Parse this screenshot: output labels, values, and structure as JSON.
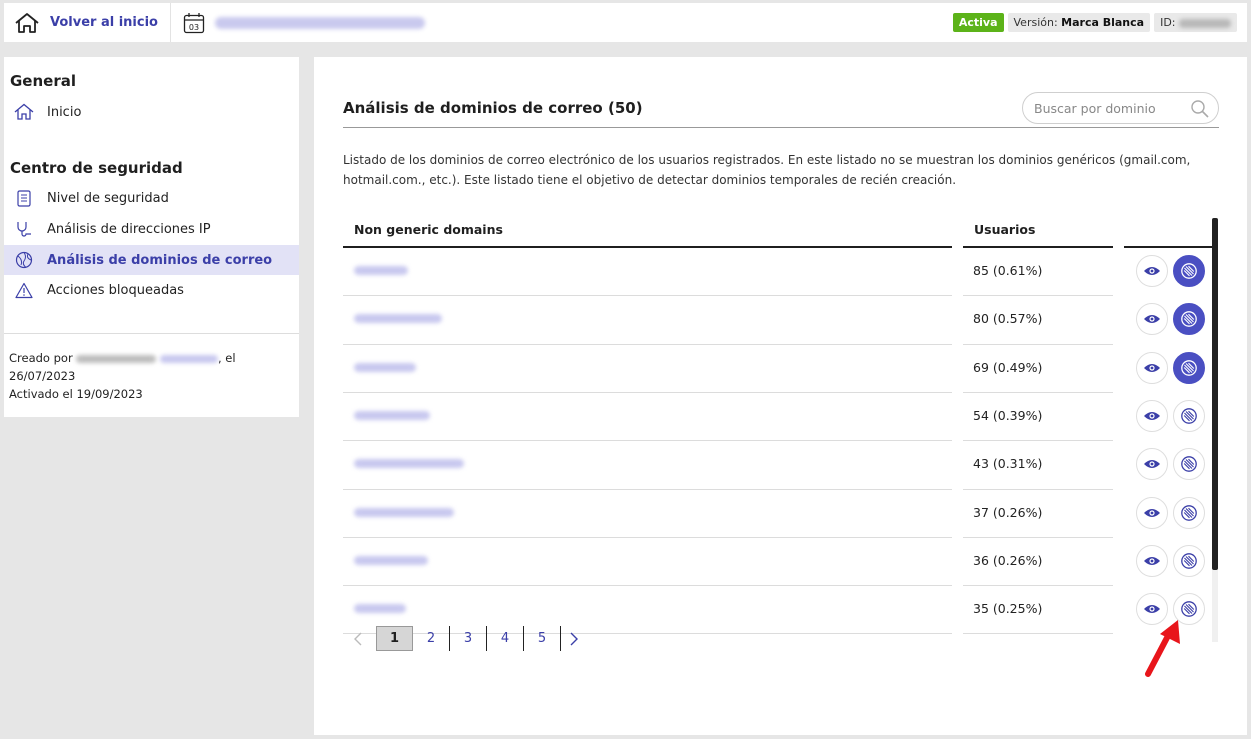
{
  "topbar": {
    "home_label": "Volver al inicio",
    "calendar_day": "03",
    "status_badge": "Activa",
    "version_label": "Versión:",
    "version_value": "Marca Blanca",
    "id_label": "ID:"
  },
  "sidebar": {
    "general_title": "General",
    "general_items": [
      {
        "label": "Inicio",
        "icon": "home-icon"
      }
    ],
    "security_title": "Centro de seguridad",
    "security_items": [
      {
        "label": "Nivel de seguridad",
        "icon": "clipboard-icon"
      },
      {
        "label": "Análisis de direcciones IP",
        "icon": "plug-icon"
      },
      {
        "label": "Análisis de dominios de correo",
        "icon": "globe-icon",
        "active": true
      },
      {
        "label": "Acciones bloqueadas",
        "icon": "warning-icon"
      }
    ],
    "created_prefix": "Creado por",
    "created_suffix": ", el",
    "created_date": "26/07/2023",
    "activated_text": "Activado el 19/09/2023"
  },
  "main": {
    "title": "Análisis de dominios de correo (50)",
    "search_placeholder": "Buscar por dominio",
    "description": "Listado de los dominios de correo electrónico de los usuarios registrados. En este listado no se muestran los dominios genéricos (gmail.com, hotmail.com., etc.). Este listado tiene el objetivo de detectar dominios temporales de recién creación.",
    "columns": {
      "domain": "Non generic domains",
      "users": "Usuarios"
    },
    "rows": [
      {
        "users": "85 (0.61%)",
        "blocked": true
      },
      {
        "users": "80 (0.57%)",
        "blocked": true
      },
      {
        "users": "69 (0.49%)",
        "blocked": true
      },
      {
        "users": "54 (0.39%)",
        "blocked": false
      },
      {
        "users": "43 (0.31%)",
        "blocked": false
      },
      {
        "users": "37 (0.26%)",
        "blocked": false
      },
      {
        "users": "36 (0.26%)",
        "blocked": false
      },
      {
        "users": "35 (0.25%)",
        "blocked": false
      }
    ],
    "pagination": [
      "1",
      "2",
      "3",
      "4",
      "5"
    ],
    "current_page": "1"
  },
  "colors": {
    "accent": "#3b3fa8",
    "button_active": "#4a4fc2",
    "status_green": "#5cb319",
    "annotation_arrow": "#e8151b"
  }
}
